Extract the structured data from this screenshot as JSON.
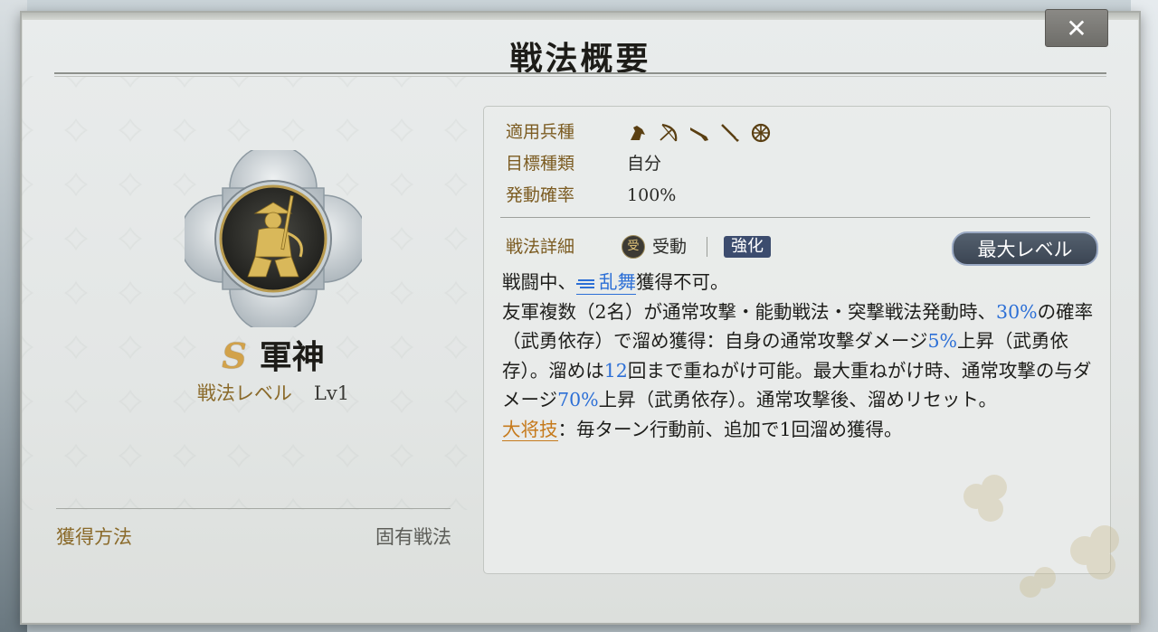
{
  "dialog": {
    "title": "戦法概要",
    "close_label": "✕"
  },
  "skill": {
    "grade": "S",
    "name": "軍神",
    "level_label": "戦法レベル",
    "level_value": "Lv1",
    "acquire_label": "獲得方法",
    "acquire_value": "固有戦法"
  },
  "info": {
    "troop_label": "適用兵種",
    "troop_icons": [
      "cavalry-icon",
      "bow-icon",
      "gun-icon",
      "spear-icon",
      "wheel-icon"
    ],
    "target_label": "目標種類",
    "target_value": "自分",
    "rate_label": "発動確率",
    "rate_value": "100%"
  },
  "detail": {
    "label": "戦法詳細",
    "passive_icon_text": "受",
    "passive_text": "受動",
    "tag": "強化",
    "max_level_button": "最大レベル"
  },
  "description": {
    "p1_a": "戦闘中、",
    "p1_ranbu": "乱舞",
    "p1_b": "獲得不可。",
    "p2_a": "友軍複数（2名）が通常攻撃・能動戦法・突撃戦法発動時、",
    "p2_v1": "30%",
    "p2_b": "の確率（武勇依存）で溜め獲得：自身の通常攻撃ダメージ",
    "p2_v2": "5%",
    "p2_c": "上昇（武勇依存）。溜めは",
    "p2_v3": "12",
    "p2_d": "回まで重ねがけ可能。最大重ねがけ時、通常攻撃の与ダメージ",
    "p2_v4": "70%",
    "p2_e": "上昇（武勇依存）。通常攻撃後、溜めリセット。",
    "p3_general": "大将技",
    "p3_text": "：毎ターン行動前、追加で1回溜め獲得。"
  },
  "colors": {
    "accent_blue": "#2c6fd6",
    "accent_orange": "#c67a1c",
    "label_brown": "#7c5c22",
    "grade_gold": "#d2a24a"
  }
}
